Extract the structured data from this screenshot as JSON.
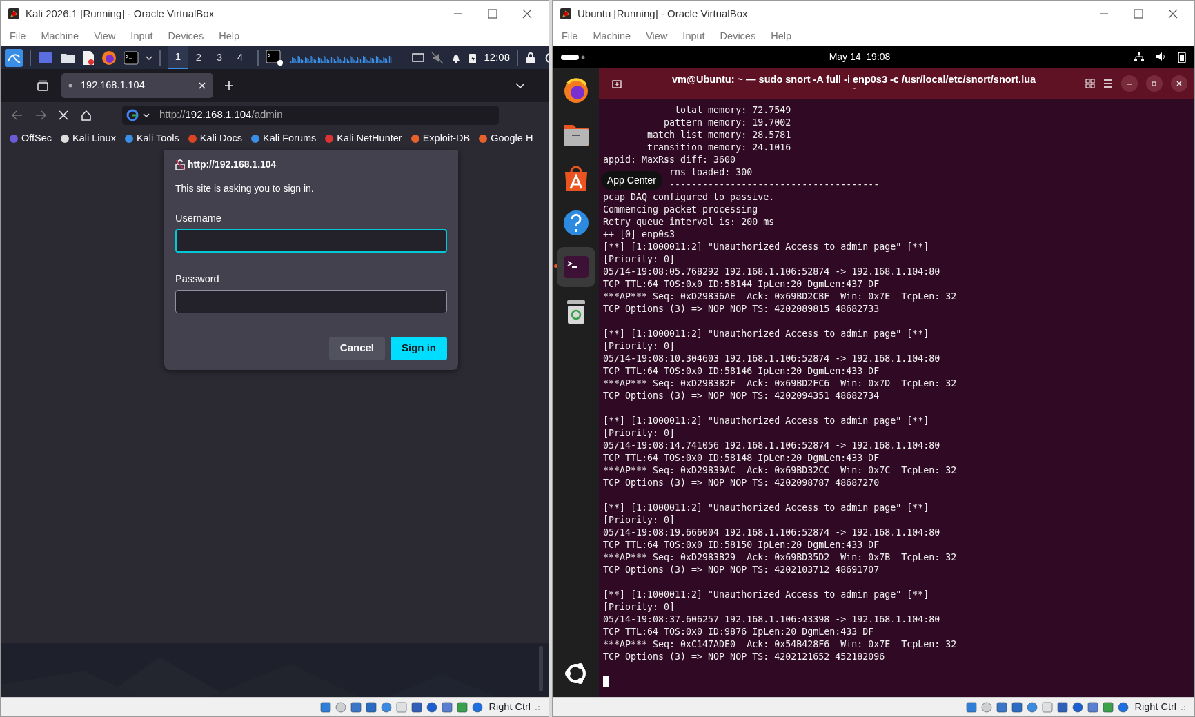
{
  "kali_window": {
    "title": "Kali 2026.1 [Running] - Oracle VirtualBox",
    "menu": [
      "File",
      "Machine",
      "View",
      "Input",
      "Devices",
      "Help"
    ],
    "panel": {
      "workspaces": [
        {
          "label": "1",
          "selected": true
        },
        {
          "label": "2",
          "selected": false
        },
        {
          "label": "3",
          "selected": false
        },
        {
          "label": "4",
          "selected": false
        }
      ],
      "clock": "12:08"
    },
    "browser": {
      "tab": {
        "title": "192.168.1.104"
      },
      "url": {
        "scheme": "http://",
        "host": "192.168.1.104",
        "path": "/admin"
      },
      "bookmarks": [
        "OffSec",
        "Kali Linux",
        "Kali Tools",
        "Kali Docs",
        "Kali Forums",
        "Kali NetHunter",
        "Exploit-DB",
        "Google H"
      ],
      "dialog": {
        "origin": "http://192.168.1.104",
        "message": "This site is asking you to sign in.",
        "fields": [
          {
            "label": "Username",
            "focused": true
          },
          {
            "label": "Password",
            "focused": false
          }
        ],
        "buttons": [
          {
            "label": "Cancel",
            "kind": "secondary"
          },
          {
            "label": "Sign in",
            "kind": "primary"
          }
        ]
      }
    },
    "status_bar": {
      "host_key": "Right Ctrl"
    }
  },
  "ubuntu_window": {
    "title": "Ubuntu [Running] - Oracle VirtualBox",
    "menu": [
      "File",
      "Machine",
      "View",
      "Input",
      "Devices",
      "Help"
    ],
    "top_bar": {
      "datetime": "May 14  19:08"
    },
    "dock": [
      {
        "kind": "browser",
        "selected": false
      },
      {
        "kind": "files",
        "selected": false
      },
      {
        "kind": "store",
        "selected": false
      },
      {
        "kind": "help",
        "selected": false
      },
      {
        "kind": "terminal",
        "selected": true
      },
      {
        "kind": "trash",
        "selected": false
      }
    ],
    "tooltip": "App Center",
    "terminal": {
      "title": "vm@Ubuntu: ~ — sudo snort -A full -i enp0s3 -c /usr/local/etc/snort/snort.lua",
      "subtitle": "~",
      "header_lines": [
        "             total memory: 72.7549",
        "           pattern memory: 19.7002",
        "        match list memory: 28.5781",
        "        transition memory: 24.1016",
        "appid: MaxRss diff: 3600",
        "            rns loaded: 300",
        "            --------------------------------------",
        "pcap DAQ configured to passive.",
        "Commencing packet processing",
        "Retry queue interval is: 200 ms",
        "++ [0] enp0s3"
      ],
      "alerts": [
        {
          "lines": [
            "[**] [1:1000011:2] \"Unauthorized Access to admin page\" [**]",
            "[Priority: 0]",
            "05/14-19:08:05.768292 192.168.1.106:52874 -> 192.168.1.104:80",
            "TCP TTL:64 TOS:0x0 ID:58144 IpLen:20 DgmLen:437 DF",
            "***AP*** Seq: 0xD29836AE  Ack: 0x69BD2CBF  Win: 0x7E  TcpLen: 32",
            "TCP Options (3) => NOP NOP TS: 4202089815 48682733"
          ]
        },
        {
          "lines": [
            "[**] [1:1000011:2] \"Unauthorized Access to admin page\" [**]",
            "[Priority: 0]",
            "05/14-19:08:10.304603 192.168.1.106:52874 -> 192.168.1.104:80",
            "TCP TTL:64 TOS:0x0 ID:58146 IpLen:20 DgmLen:433 DF",
            "***AP*** Seq: 0xD298382F  Ack: 0x69BD2FC6  Win: 0x7D  TcpLen: 32",
            "TCP Options (3) => NOP NOP TS: 4202094351 48682734"
          ]
        },
        {
          "lines": [
            "[**] [1:1000011:2] \"Unauthorized Access to admin page\" [**]",
            "[Priority: 0]",
            "05/14-19:08:14.741056 192.168.1.106:52874 -> 192.168.1.104:80",
            "TCP TTL:64 TOS:0x0 ID:58148 IpLen:20 DgmLen:433 DF",
            "***AP*** Seq: 0xD29839AC  Ack: 0x69BD32CC  Win: 0x7C  TcpLen: 32",
            "TCP Options (3) => NOP NOP TS: 4202098787 48687270"
          ]
        },
        {
          "lines": [
            "[**] [1:1000011:2] \"Unauthorized Access to admin page\" [**]",
            "[Priority: 0]",
            "05/14-19:08:19.666004 192.168.1.106:52874 -> 192.168.1.104:80",
            "TCP TTL:64 TOS:0x0 ID:58150 IpLen:20 DgmLen:433 DF",
            "***AP*** Seq: 0xD2983B29  Ack: 0x69BD35D2  Win: 0x7B  TcpLen: 32",
            "TCP Options (3) => NOP NOP TS: 4202103712 48691707"
          ]
        },
        {
          "lines": [
            "[**] [1:1000011:2] \"Unauthorized Access to admin page\" [**]",
            "[Priority: 0]",
            "05/14-19:08:37.606257 192.168.1.106:43398 -> 192.168.1.104:80",
            "TCP TTL:64 TOS:0x0 ID:9876 IpLen:20 DgmLen:433 DF",
            "***AP*** Seq: 0xC147ADE0  Ack: 0x54B428F6  Win: 0x7E  TcpLen: 32",
            "TCP Options (3) => NOP NOP TS: 4202121652 452182096"
          ]
        }
      ]
    },
    "status_bar": {
      "host_key": "Right Ctrl"
    }
  }
}
